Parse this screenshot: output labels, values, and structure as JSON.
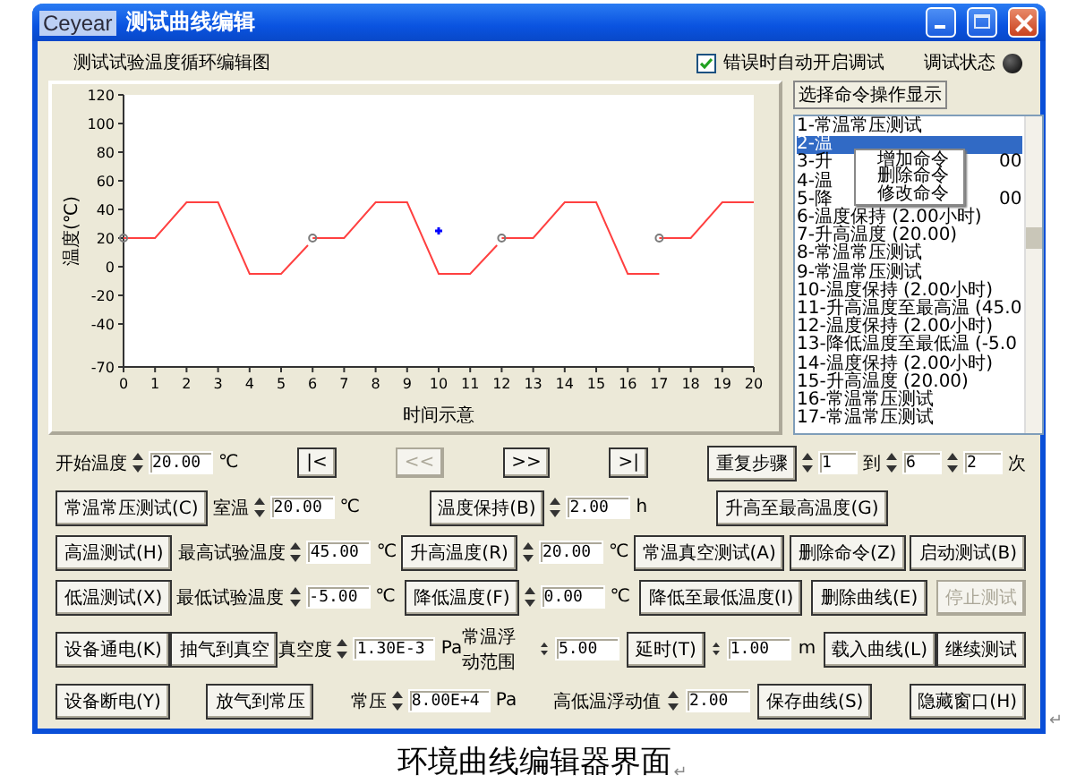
{
  "window": {
    "logo": "Ceyear",
    "title": "测试曲线编辑"
  },
  "top_bar": {
    "chart_caption": "测试试验温度循环编辑图",
    "auto_debug": {
      "label": "错误时自动开启调试",
      "checked": true
    },
    "status": {
      "label": "调试状态",
      "on": false
    }
  },
  "chart": {
    "chart_data": {
      "type": "line",
      "xlabel": "时间示意",
      "ylabel": "温度(℃)",
      "x": [
        0,
        1,
        2,
        3,
        4,
        5,
        5.85,
        6,
        7,
        8,
        9,
        10,
        11,
        11.85,
        12,
        13,
        14,
        15,
        16,
        17,
        18,
        19,
        20
      ],
      "xlim": [
        0,
        20
      ],
      "ylim": [
        -70,
        120
      ],
      "xticks": [
        0,
        1,
        2,
        3,
        4,
        5,
        6,
        7,
        8,
        9,
        10,
        11,
        12,
        13,
        14,
        15,
        16,
        17,
        18,
        19,
        20
      ],
      "yticks": [
        120,
        100,
        80,
        60,
        40,
        20,
        0,
        -20,
        -40,
        -70
      ],
      "series": [
        {
          "color": "#ff4040",
          "values": [
            20,
            20,
            45,
            45,
            -5,
            -5,
            15,
            null,
            null,
            null,
            null,
            null,
            null,
            null,
            null,
            null,
            null,
            null,
            null,
            null,
            null,
            null,
            null
          ]
        },
        {
          "color": "#ff4040",
          "values": [
            null,
            null,
            null,
            null,
            null,
            null,
            null,
            20,
            20,
            45,
            45,
            -5,
            -5,
            15,
            null,
            null,
            null,
            null,
            null,
            null,
            null,
            null,
            null
          ]
        },
        {
          "color": "#ff4040",
          "values": [
            null,
            null,
            null,
            null,
            null,
            null,
            null,
            null,
            null,
            null,
            null,
            null,
            null,
            null,
            20,
            20,
            45,
            45,
            -5,
            -5,
            null,
            null,
            null
          ]
        },
        {
          "color": "#ff4040",
          "values": [
            null,
            null,
            null,
            null,
            null,
            null,
            null,
            null,
            null,
            null,
            null,
            null,
            null,
            null,
            null,
            null,
            null,
            null,
            null,
            20,
            20,
            45,
            45
          ]
        },
        {
          "color": "#0000ff",
          "marker": "cross",
          "values": [
            null,
            null,
            null,
            null,
            null,
            null,
            null,
            null,
            null,
            null,
            null,
            25,
            null,
            null,
            null,
            null,
            null,
            null,
            null,
            null,
            null,
            null,
            null
          ]
        }
      ]
    }
  },
  "command_panel": {
    "header": "选择命令操作显示",
    "items": [
      {
        "text": "1-常温常压测试",
        "selected": false
      },
      {
        "text": "2-温",
        "selected": true
      },
      {
        "text": "3-升",
        "tail": "00",
        "selected": false
      },
      {
        "text": "4-温",
        "selected": false
      },
      {
        "text": "5-降",
        "tail": "00",
        "selected": false
      },
      {
        "text": "6-温度保持 (2.00小时)",
        "selected": false
      },
      {
        "text": "7-升高温度 (20.00)",
        "selected": false
      },
      {
        "text": "8-常温常压测试",
        "selected": false
      },
      {
        "text": "9-常温常压测试",
        "selected": false
      },
      {
        "text": "10-温度保持 (2.00小时)",
        "selected": false
      },
      {
        "text": "11-升高温度至最高温 (45.0",
        "selected": false
      },
      {
        "text": "12-温度保持 (2.00小时)",
        "selected": false
      },
      {
        "text": "13-降低温度至最低温 (-5.0",
        "selected": false
      },
      {
        "text": "14-温度保持 (2.00小时)",
        "selected": false
      },
      {
        "text": "15-升高温度 (20.00)",
        "selected": false
      },
      {
        "text": "16-常温常压测试",
        "selected": false
      },
      {
        "text": "17-常温常压测试",
        "selected": false
      }
    ],
    "context_menu": [
      "增加命令",
      "删除命令",
      "修改命令"
    ]
  },
  "form_rows": [
    {
      "kind": "nav",
      "groups": [
        [
          {
            "kind": "label",
            "text": "开始温度"
          },
          {
            "kind": "spin",
            "value": "20.00"
          },
          {
            "kind": "unit",
            "text": "℃"
          }
        ],
        [
          {
            "kind": "button",
            "label": "|<",
            "disabled": false
          }
        ],
        [
          {
            "kind": "button",
            "label": "<<",
            "disabled": true
          }
        ],
        [
          {
            "kind": "button",
            "label": ">>",
            "disabled": false
          }
        ],
        [
          {
            "kind": "button",
            "label": ">|",
            "disabled": false
          }
        ],
        [
          {
            "kind": "button",
            "label": "重复步骤",
            "disabled": false
          },
          {
            "kind": "spin",
            "value": "1"
          },
          {
            "kind": "label",
            "text": "到"
          },
          {
            "kind": "spin",
            "value": "6"
          },
          {
            "kind": "spin",
            "value": "2"
          },
          {
            "kind": "label",
            "text": "次"
          }
        ]
      ]
    },
    {
      "kind": "test",
      "groups": [
        [
          {
            "kind": "button",
            "label": "常温常压测试(C)",
            "disabled": false
          },
          {
            "kind": "label",
            "text": "室温"
          },
          {
            "kind": "spin",
            "value": "20.00"
          },
          {
            "kind": "unit",
            "text": "℃"
          }
        ],
        [
          {
            "kind": "button",
            "label": "温度保持(B)",
            "disabled": false
          },
          {
            "kind": "spin",
            "value": "2.00"
          },
          {
            "kind": "unit",
            "text": "h"
          }
        ],
        [
          {
            "kind": "button",
            "label": "升高至最高温度(G)",
            "disabled": false
          }
        ]
      ]
    },
    {
      "kind": "test",
      "groups": [
        [
          {
            "kind": "button",
            "label": "高温测试(H)",
            "disabled": false
          },
          {
            "kind": "label",
            "text": "最高试验温度"
          },
          {
            "kind": "spin",
            "value": "45.00"
          },
          {
            "kind": "unit",
            "text": "℃"
          }
        ],
        [
          {
            "kind": "button",
            "label": "升高温度(R)",
            "disabled": false
          },
          {
            "kind": "spin",
            "value": "20.00"
          },
          {
            "kind": "unit",
            "text": "℃"
          }
        ],
        [
          {
            "kind": "button",
            "label": "常温真空测试(A)",
            "disabled": false
          }
        ],
        [
          {
            "kind": "button",
            "label": "删除命令(Z)",
            "disabled": false
          }
        ],
        [
          {
            "kind": "button",
            "label": "启动测试(B)",
            "disabled": false
          }
        ]
      ]
    },
    {
      "kind": "test",
      "groups": [
        [
          {
            "kind": "button",
            "label": "低温测试(X)",
            "disabled": false
          },
          {
            "kind": "label",
            "text": "最低试验温度"
          },
          {
            "kind": "spin",
            "value": "-5.00"
          },
          {
            "kind": "unit",
            "text": "℃"
          }
        ],
        [
          {
            "kind": "button",
            "label": "降低温度(F)",
            "disabled": false
          },
          {
            "kind": "spin",
            "value": "0.00"
          },
          {
            "kind": "unit",
            "text": "℃"
          }
        ],
        [
          {
            "kind": "button",
            "label": "降低至最低温度(I)",
            "disabled": false
          }
        ],
        [
          {
            "kind": "button",
            "label": "删除曲线(E)",
            "disabled": false
          }
        ],
        [
          {
            "kind": "button",
            "label": "停止测试",
            "disabled": true
          }
        ]
      ]
    },
    {
      "kind": "device",
      "groups": [
        [
          {
            "kind": "button",
            "label": "设备通电(K)",
            "disabled": false
          }
        ],
        [
          {
            "kind": "button",
            "label": "抽气到真空",
            "disabled": false
          }
        ],
        [
          {
            "kind": "label",
            "text": "真空度"
          },
          {
            "kind": "spin",
            "value": "1.30E-3"
          },
          {
            "kind": "unit",
            "text": "Pa"
          }
        ],
        [
          {
            "kind": "label",
            "text": "常温浮动范围"
          },
          {
            "kind": "spin",
            "value": "5.00"
          },
          {
            "kind": "button",
            "label": "延时(T)",
            "disabled": false
          },
          {
            "kind": "spin",
            "value": "1.00"
          },
          {
            "kind": "unit",
            "text": "m"
          },
          {
            "kind": "button",
            "label": "载入曲线(L)",
            "disabled": false
          }
        ],
        [
          {
            "kind": "button",
            "label": "继续测试",
            "disabled": false
          }
        ]
      ]
    },
    {
      "kind": "device",
      "groups": [
        [
          {
            "kind": "button",
            "label": "设备断电(Y)",
            "disabled": false
          }
        ],
        [
          {
            "kind": "button",
            "label": "放气到常压",
            "disabled": false
          }
        ],
        [
          {
            "kind": "label",
            "text": "常压"
          },
          {
            "kind": "spin",
            "value": "8.00E+4"
          },
          {
            "kind": "unit",
            "text": "Pa"
          }
        ],
        [
          {
            "kind": "label",
            "text": "高低温浮动值"
          },
          {
            "kind": "spin",
            "value": "2.00"
          },
          {
            "kind": "button",
            "label": "保存曲线(S)",
            "disabled": false
          }
        ],
        [
          {
            "kind": "button",
            "label": "隐藏窗口(H)",
            "disabled": false
          }
        ]
      ]
    }
  ],
  "document": {
    "side_mark": "↵",
    "caption": "环境曲线编辑器界面",
    "caption_mark": "↵"
  }
}
